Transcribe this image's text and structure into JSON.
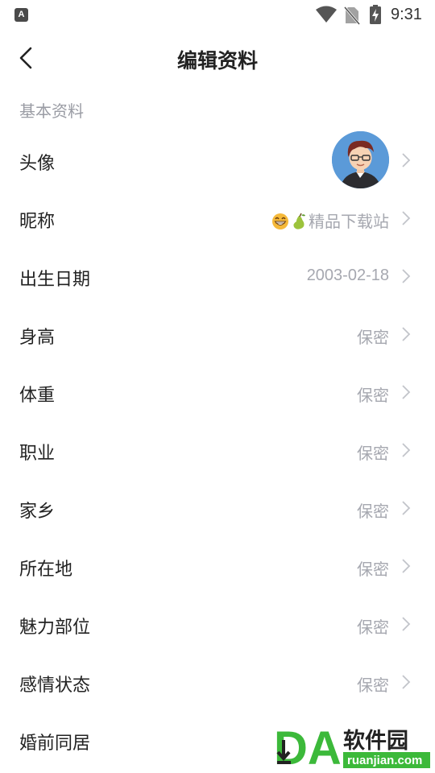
{
  "status_bar": {
    "app_icon_letter": "A",
    "time": "9:31"
  },
  "header": {
    "title": "编辑资料"
  },
  "section": {
    "label": "基本资料"
  },
  "rows": [
    {
      "label": "头像",
      "value": ""
    },
    {
      "label": "昵称",
      "value": "精品下载站"
    },
    {
      "label": "出生日期",
      "value": "2003-02-18"
    },
    {
      "label": "身高",
      "value": "保密"
    },
    {
      "label": "体重",
      "value": "保密"
    },
    {
      "label": "职业",
      "value": "保密"
    },
    {
      "label": "家乡",
      "value": "保密"
    },
    {
      "label": "所在地",
      "value": "保密"
    },
    {
      "label": "魅力部位",
      "value": "保密"
    },
    {
      "label": "感情状态",
      "value": "保密"
    },
    {
      "label": "婚前同居",
      "value": ""
    }
  ],
  "watermark": {
    "brand": "软件园",
    "url": "ruanjian.com",
    "logo_text": "DA"
  },
  "icons": {
    "back": "back-arrow-icon",
    "chevron": "chevron-right-icon",
    "wifi": "wifi-icon",
    "no_sim": "no-sim-icon",
    "battery": "battery-charging-icon"
  },
  "colors": {
    "label_text": "#222222",
    "value_text": "#a6a8b0",
    "section_text": "#9a9ca4",
    "avatar_bg": "#5b9ad8",
    "watermark_green": "#3cb93a"
  }
}
